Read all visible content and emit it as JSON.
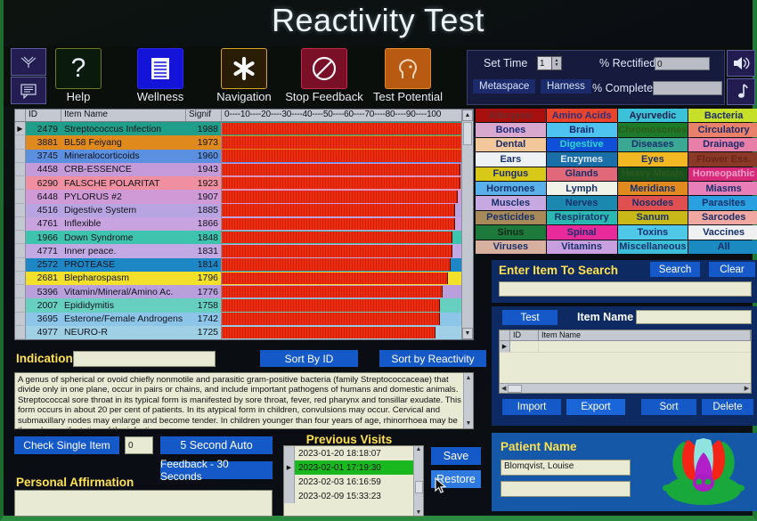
{
  "app": {
    "title": "Reactivity Test"
  },
  "toolbar": {
    "mini_icons": [
      {
        "name": "signal-antenna-icon"
      },
      {
        "name": "speech-bubble-icon"
      }
    ],
    "items": [
      {
        "label": "Help",
        "icon": "question-mark-icon",
        "key": "help"
      },
      {
        "label": "Wellness",
        "icon": "document-lines-icon",
        "key": "well"
      },
      {
        "label": "Navigation",
        "icon": "asterisk-star-icon",
        "key": "nav"
      },
      {
        "label": "Stop Feedback",
        "icon": "no-entry-icon",
        "key": "stop"
      },
      {
        "label": "Test Potential",
        "icon": "head-profile-icon",
        "key": "pot"
      }
    ]
  },
  "top_right": {
    "set_time_label": "Set Time",
    "set_time_value": "1",
    "rectified_label": "% Rectified",
    "rectified_value": "0",
    "metaspace_label": "Metaspace",
    "harness_label": "Harness",
    "completed_label": "% Completed",
    "completed_value": "",
    "speaker_icon": "speaker-icon",
    "music_icon": "music-note-icon"
  },
  "grid": {
    "headers": {
      "id": "ID",
      "name": "Item Name",
      "signif": "Signif"
    },
    "axis": "0----10----20----30----40----50----60----70----80----90----100",
    "rows": [
      {
        "id": "2479",
        "name": "Streptococcus Infection",
        "signif": "1988",
        "bar": 97,
        "color": "#1f9e8a",
        "selected": true
      },
      {
        "id": "3881",
        "name": "BL58 Feiyang",
        "signif": "1973",
        "bar": 96,
        "color": "#e08a1e",
        "selected": false
      },
      {
        "id": "3745",
        "name": "Mineralocorticoids",
        "signif": "1960",
        "bar": 97,
        "color": "#5b8fe0",
        "selected": false
      },
      {
        "id": "4458",
        "name": "CRB-ESSENCE",
        "signif": "1943",
        "bar": 95,
        "color": "#c49ad8",
        "selected": false
      },
      {
        "id": "6290",
        "name": "FALSCHE POLARITAT",
        "signif": "1923",
        "bar": 95,
        "color": "#ef8fa0",
        "selected": false
      },
      {
        "id": "6448",
        "name": "PYLORUS #2",
        "signif": "1907",
        "bar": 94,
        "color": "#cf9ad6",
        "selected": false
      },
      {
        "id": "4516",
        "name": "Digestive System",
        "signif": "1885",
        "bar": 93,
        "color": "#b9a4e2",
        "selected": false
      },
      {
        "id": "4761",
        "name": "Inflexible",
        "signif": "1866",
        "bar": 93,
        "color": "#c8a3e0",
        "selected": false
      },
      {
        "id": "1966",
        "name": "Down Syndrome",
        "signif": "1848",
        "bar": 92,
        "color": "#3ec4ae",
        "selected": false
      },
      {
        "id": "4771",
        "name": "Inner peace.",
        "signif": "1831",
        "bar": 92,
        "color": "#c3a9e4",
        "selected": false
      },
      {
        "id": "2572",
        "name": "PROTEASE",
        "signif": "1814",
        "bar": 91,
        "color": "#1d86c4",
        "selected": false
      },
      {
        "id": "2681",
        "name": "Blepharospasm",
        "signif": "1796",
        "bar": 90,
        "color": "#f2e02a",
        "selected": false
      },
      {
        "id": "5396",
        "name": "Vitamin/Mineral/Amino Ac.",
        "signif": "1776",
        "bar": 88,
        "color": "#b9a0dd",
        "selected": false
      },
      {
        "id": "2007",
        "name": "Epididymitis",
        "signif": "1758",
        "bar": 87,
        "color": "#67cfc0",
        "selected": false
      },
      {
        "id": "3695",
        "name": "Esterone/Female Androgens",
        "signif": "1742",
        "bar": 87,
        "color": "#8cc5e8",
        "selected": false
      },
      {
        "id": "4977",
        "name": "NEURO-R",
        "signif": "1725",
        "bar": 85,
        "color": "#9fd0e6",
        "selected": false
      }
    ]
  },
  "categories": [
    {
      "label": "Allergens",
      "bg": "#a81010",
      "fg": "#6b2b2b"
    },
    {
      "label": "Amino Acids",
      "bg": "#e8442c",
      "fg": "#2b2f7a"
    },
    {
      "label": "Ayurvedic",
      "bg": "#3bc2d8",
      "fg": "#17204a"
    },
    {
      "label": "Bacteria",
      "bg": "#c6e02a",
      "fg": "#1b2a6b"
    },
    {
      "label": "Bones",
      "bg": "#d8a8cf",
      "fg": "#1b2a7a"
    },
    {
      "label": "Brain",
      "bg": "#4fc3f0",
      "fg": "#14276b"
    },
    {
      "label": "Chromosomes",
      "bg": "#1d7a2a",
      "fg": "#2c5a18"
    },
    {
      "label": "Circulatory",
      "bg": "#e8806a",
      "fg": "#1d2a6b"
    },
    {
      "label": "Dental",
      "bg": "#f2c89a",
      "fg": "#1b2a6b"
    },
    {
      "label": "Digestive",
      "bg": "#1050d8",
      "fg": "#2ad8d0"
    },
    {
      "label": "Diseases",
      "bg": "#3ba894",
      "fg": "#16306b"
    },
    {
      "label": "Drainage",
      "bg": "#e87fa8",
      "fg": "#1b2a6b"
    },
    {
      "label": "Ears",
      "bg": "#eef2f5",
      "fg": "#16306b"
    },
    {
      "label": "Enzymes",
      "bg": "#1b6fa8",
      "fg": "#dfe8f5"
    },
    {
      "label": "Eyes",
      "bg": "#f2b824",
      "fg": "#16306b"
    },
    {
      "label": "Flower Ess.",
      "bg": "#8a3a26",
      "fg": "#6b2418"
    },
    {
      "label": "Fungus",
      "bg": "#d8c818",
      "fg": "#1b2a6b"
    },
    {
      "label": "Glands",
      "bg": "#e06878",
      "fg": "#15306b"
    },
    {
      "label": "Heavy Metals",
      "bg": "#18501c",
      "fg": "#2a5a1a"
    },
    {
      "label": "Homeopathic",
      "bg": "#d82a7a",
      "fg": "#f2a0c8"
    },
    {
      "label": "Hormones",
      "bg": "#5ab0e8",
      "fg": "#16306b"
    },
    {
      "label": "Lymph",
      "bg": "#f0f2e8",
      "fg": "#16306b"
    },
    {
      "label": "Meridians",
      "bg": "#e08a20",
      "fg": "#16306b"
    },
    {
      "label": "Miasms",
      "bg": "#e87fb8",
      "fg": "#16306b"
    },
    {
      "label": "Muscles",
      "bg": "#c8a8e0",
      "fg": "#16306b"
    },
    {
      "label": "Nerves",
      "bg": "#1b88b0",
      "fg": "#16306b"
    },
    {
      "label": "Nosodes",
      "bg": "#e05050",
      "fg": "#16306b"
    },
    {
      "label": "Parasites",
      "bg": "#2aa0e0",
      "fg": "#16306b"
    },
    {
      "label": "Pesticides",
      "bg": "#a88a5a",
      "fg": "#16306b"
    },
    {
      "label": "Respiratory",
      "bg": "#2ab8b0",
      "fg": "#16306b"
    },
    {
      "label": "Sanum",
      "bg": "#c8b818",
      "fg": "#16306b"
    },
    {
      "label": "Sarcodes",
      "bg": "#f0a8a0",
      "fg": "#16306b"
    },
    {
      "label": "Sinus",
      "bg": "#1d7a3a",
      "fg": "#0f2a1a"
    },
    {
      "label": "Spinal",
      "bg": "#e82a9a",
      "fg": "#16306b"
    },
    {
      "label": "Toxins",
      "bg": "#4fc8e8",
      "fg": "#16306b"
    },
    {
      "label": "Vaccines",
      "bg": "#eef0f2",
      "fg": "#16306b"
    },
    {
      "label": "Viruses",
      "bg": "#d8b0a0",
      "fg": "#16306b"
    },
    {
      "label": "Vitamins",
      "bg": "#c8a0e0",
      "fg": "#16306b"
    },
    {
      "label": "Miscellaneous",
      "bg": "#3bbfd8",
      "fg": "#16306b"
    },
    {
      "label": "All",
      "bg": "#1b8ac0",
      "fg": "#16306b"
    }
  ],
  "search": {
    "title": "Enter Item To Search",
    "search_button": "Search",
    "clear_button": "Clear",
    "input_value": ""
  },
  "item_panel": {
    "test_button": "Test",
    "item_name_label": "Item Name",
    "item_name_value": "",
    "headers": {
      "id": "ID",
      "name": "Item Name"
    },
    "import_button": "Import",
    "export_button": "Export",
    "sort_button": "Sort",
    "delete_button": "Delete"
  },
  "indication": {
    "label": "Indication",
    "value": "",
    "sort_by_id": "Sort By ID",
    "sort_by_reactivity": "Sort by Reactivity",
    "description": "A genus of spherical or ovoid chiefly nonmotile and parasitic gram-positive bacteria (family Streptococcaceae) that divide only in one plane, occur in pairs or chains, and include important pathogens of humans and domestic animals. Streptococcal sore throat in its typical form is manifested by sore throat, fever, red pharynx and tonsillar exudate. This form occurs in about 20 per cent of patients. In its atypical form in children, convulsions may occur. Cervical and submaxillary nodes may enlarge and become tender. In children younger than four years of age, rhinorrhoea may be the sole manifestation of the infection."
  },
  "bottom_left": {
    "check_single_item": "Check Single Item",
    "check_value": "0",
    "five_second_auto": "5 Second Auto",
    "feedback_30": "Feedback - 30 Seconds",
    "personal_affirmation": "Personal Affirmation",
    "affirmation_value": ""
  },
  "visits": {
    "title": "Previous Visits",
    "items": [
      {
        "date": "2023-01-20 18:18:07",
        "selected": false
      },
      {
        "date": "2023-02-01 17:19:30",
        "selected": true
      },
      {
        "date": "2023-02-03 16:16:59",
        "selected": false
      },
      {
        "date": "2023-02-09 15:33:23",
        "selected": false
      }
    ],
    "save_button": "Save",
    "restore_button": "Restore"
  },
  "patient": {
    "label": "Patient Name",
    "name": "Blomqvist, Louise",
    "second_field": ""
  }
}
